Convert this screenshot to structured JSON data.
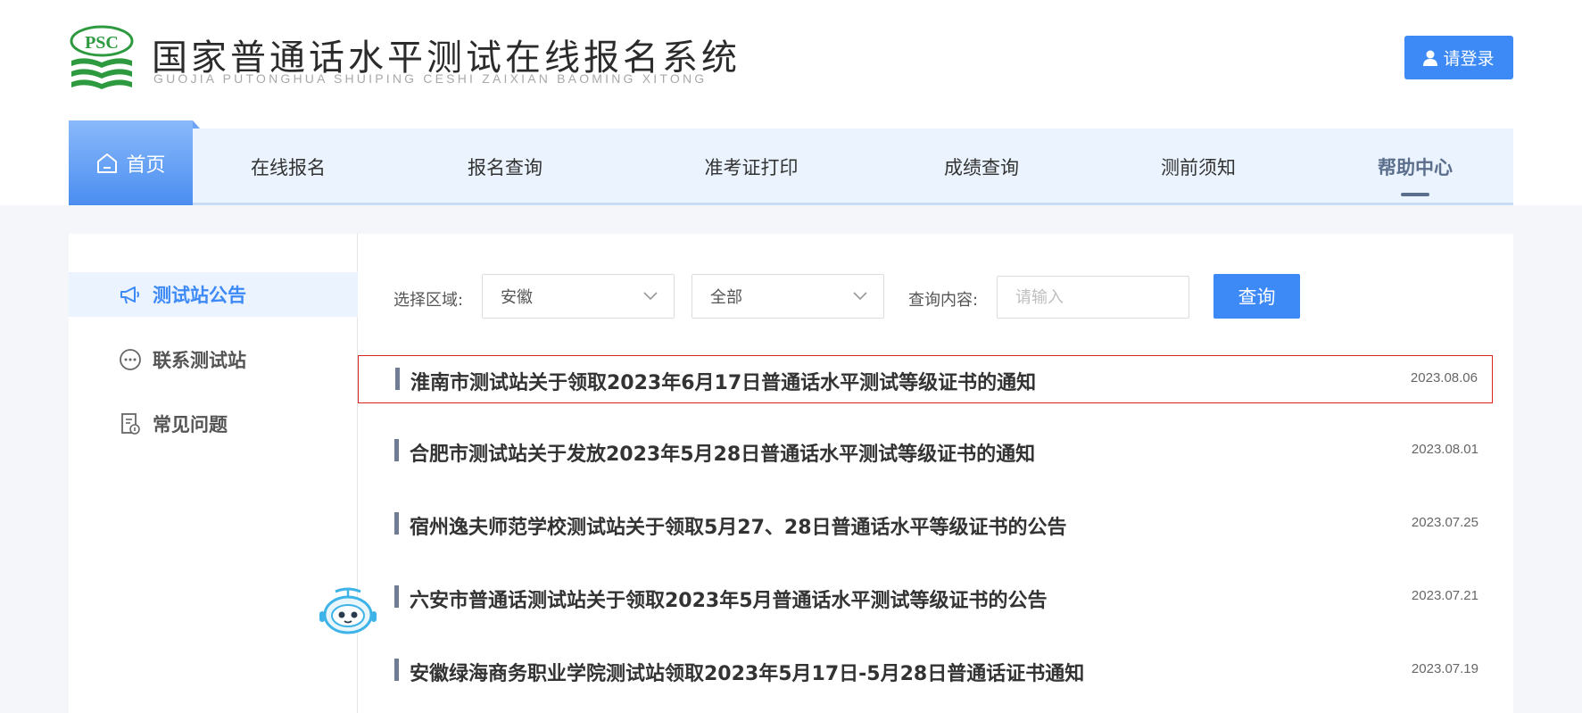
{
  "header": {
    "logo_text": "PSC",
    "title": "国家普通话水平测试在线报名系统",
    "subtitle": "GUOJIA PUTONGHUA SHUIPING CESHI ZAIXIAN BAOMING XITONG",
    "login_label": "请登录"
  },
  "nav": {
    "home_label": "首页",
    "items": [
      {
        "label": "在线报名"
      },
      {
        "label": "报名查询"
      },
      {
        "label": "准考证打印"
      },
      {
        "label": "成绩查询"
      },
      {
        "label": "测前须知"
      },
      {
        "label": "帮助中心"
      }
    ],
    "active": "帮助中心"
  },
  "sidebar": {
    "items": [
      {
        "label": "测试站公告",
        "icon": "megaphone-icon"
      },
      {
        "label": "联系测试站",
        "icon": "chat-bubble-icon"
      },
      {
        "label": "常见问题",
        "icon": "document-question-icon"
      }
    ]
  },
  "filters": {
    "region_label": "选择区域:",
    "region_value": "安徽",
    "scope_value": "全部",
    "query_label": "查询内容:",
    "query_placeholder": "请输入",
    "query_button": "查询"
  },
  "news": [
    {
      "title": "淮南市测试站关于领取2023年6月17日普通话水平测试等级证书的通知",
      "date": "2023.08.06"
    },
    {
      "title": "合肥市测试站关于发放2023年5月28日普通话水平测试等级证书的通知",
      "date": "2023.08.01"
    },
    {
      "title": "宿州逸夫师范学校测试站关于领取5月27、28日普通话水平等级证书的公告",
      "date": "2023.07.25"
    },
    {
      "title": "六安市普通话测试站关于领取2023年5月普通话水平测试等级证书的公告",
      "date": "2023.07.21"
    },
    {
      "title": "安徽绿海商务职业学院测试站领取2023年5月17日-5月28日普通话证书通知",
      "date": "2023.07.19"
    }
  ],
  "colors": {
    "accent": "#3d8af7",
    "nav_bg": "#eaf3fe",
    "highlight_border": "#d9241f",
    "logo_green": "#2e9a3f"
  }
}
